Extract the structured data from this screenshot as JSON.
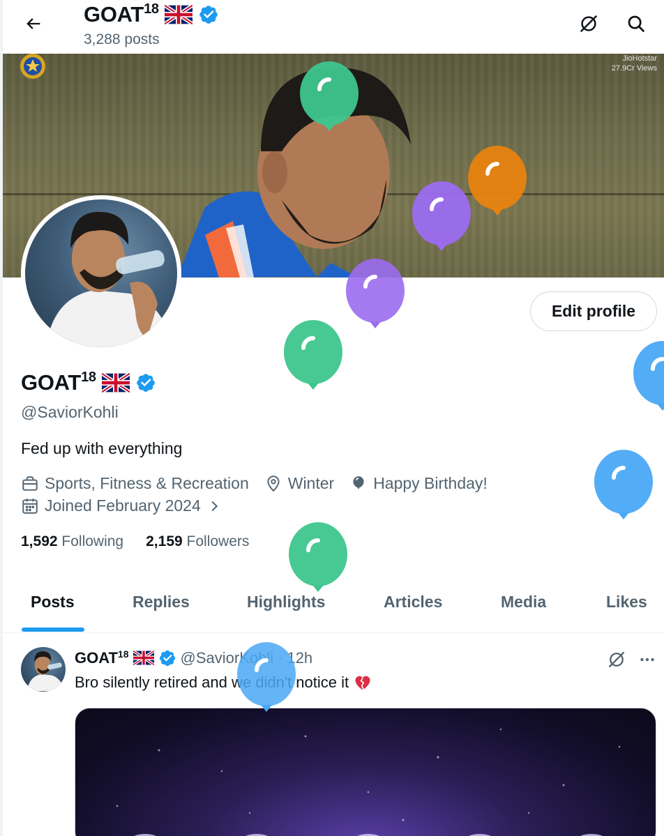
{
  "header": {
    "display_name": "GOAT",
    "name_superscript": "18",
    "post_count": "3,288 posts"
  },
  "banner": {
    "watermark_line1": "JioHotstar",
    "watermark_line2": "27.9Cr Views"
  },
  "profile": {
    "edit_label": "Edit profile",
    "display_name": "GOAT",
    "name_superscript": "18",
    "handle": "@SaviorKohli",
    "bio": "Fed up with everything",
    "category": "Sports, Fitness & Recreation",
    "location": "Winter",
    "birthday": "Happy Birthday!",
    "joined": "Joined February 2024",
    "following_count": "1,592",
    "following_label": "Following",
    "followers_count": "2,159",
    "followers_label": "Followers"
  },
  "tabs": [
    {
      "label": "Posts",
      "active": true
    },
    {
      "label": "Replies",
      "active": false
    },
    {
      "label": "Highlights",
      "active": false
    },
    {
      "label": "Articles",
      "active": false
    },
    {
      "label": "Media",
      "active": false
    },
    {
      "label": "Likes",
      "active": false
    }
  ],
  "post": {
    "display_name": "GOAT",
    "name_superscript": "18",
    "handle": "@SaviorKohli",
    "separator": "·",
    "time": "12h",
    "text": "Bro silently retired and we didn't notice it"
  },
  "icons": {
    "back": "arrow-left-icon",
    "grok": "grok-icon",
    "search": "search-icon",
    "verified": "verified-badge-icon",
    "flag": "uk-flag-icon",
    "briefcase": "briefcase-icon",
    "location": "location-pin-icon",
    "balloon": "balloon-icon",
    "calendar": "calendar-icon",
    "chevron": "chevron-right-icon",
    "more": "more-dots-icon",
    "broken_heart": "broken-heart-emoji"
  },
  "colors": {
    "accent": "#1d9bf0",
    "text_primary": "#0f1419",
    "text_secondary": "#536471",
    "balloon_green": "#3ec68e",
    "balloon_purple": "#9b6cf0",
    "balloon_orange": "#e8830f",
    "balloon_blue": "#4aa8f5"
  }
}
